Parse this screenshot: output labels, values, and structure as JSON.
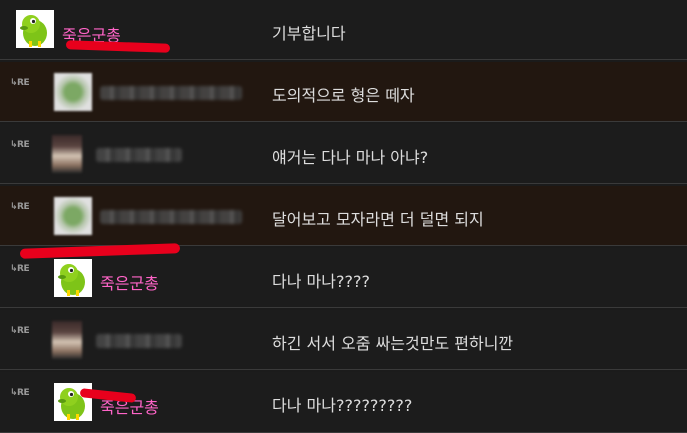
{
  "reply_marker": "RE",
  "rows": [
    {
      "nickname": "죽은군총",
      "comment": "기부합니다",
      "is_reply": false
    },
    {
      "nickname": "",
      "comment": "도의적으로 형은 떼자",
      "is_reply": true
    },
    {
      "nickname": "",
      "comment": "얘거는 다나 마나 아냐?",
      "is_reply": true
    },
    {
      "nickname": "",
      "comment": "달어보고 모자라면 더 덜면 되지",
      "is_reply": true
    },
    {
      "nickname": "죽은군총",
      "comment": "다나 마나????",
      "is_reply": true
    },
    {
      "nickname": "",
      "comment": "하긴 서서 오줌 싸는것만도 편하니깐",
      "is_reply": true
    },
    {
      "nickname": "죽은군총",
      "comment": "다나 마나?????????",
      "is_reply": true
    }
  ],
  "colors": {
    "nickname": "#ff64c8",
    "comment_text": "#dddddd",
    "row_bg": "#1c1c1c",
    "row_highlight_bg": "#221710",
    "censor_mark": "#e8001c"
  }
}
